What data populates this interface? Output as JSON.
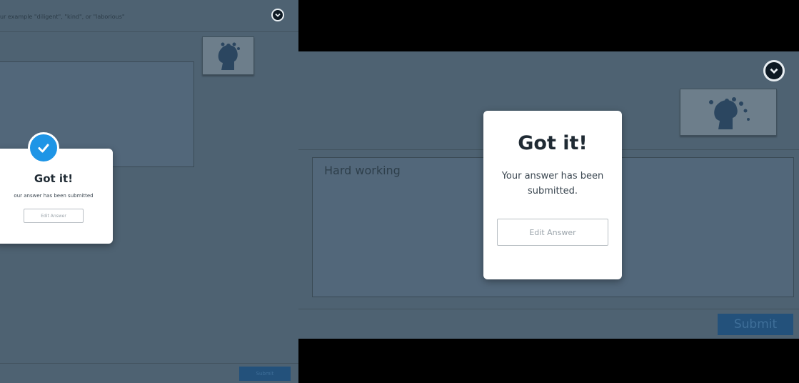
{
  "left_panel": {
    "hint_text": "ur example \"diligent\", \"kind\", or \"laborious\"",
    "modal": {
      "title": "Got it!",
      "message": "our answer has been submitted",
      "edit_label": "Edit Answer"
    },
    "submit_label": "Submit"
  },
  "right_panel": {
    "answer_text": "Hard working",
    "modal": {
      "title": "Got it!",
      "message": "Your answer has been submitted.",
      "edit_label": "Edit Answer"
    },
    "submit_label": "Submit"
  },
  "icons": {
    "collapse": "chevron-down-icon",
    "success": "check-icon",
    "thumbnail": "brain-head-icon"
  },
  "colors": {
    "accent": "#1e95e6",
    "overlay": "#4e6272",
    "submit_button": "#23517b"
  }
}
